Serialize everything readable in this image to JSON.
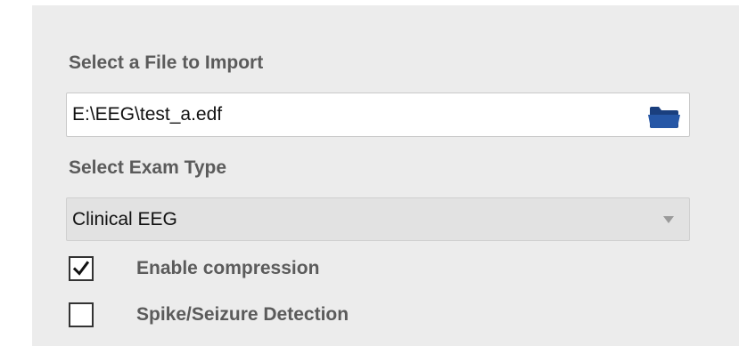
{
  "import_dialog": {
    "file_section": {
      "heading": "Select a File to Import",
      "file_path": "E:\\EEG\\test_a.edf",
      "browse_icon": "folder-icon"
    },
    "exam_section": {
      "heading": "Select Exam Type",
      "selected": "Clinical EEG",
      "dropdown_icon": "chevron-down-icon"
    },
    "options": [
      {
        "label": "Enable compression",
        "checked": true
      },
      {
        "label": "Spike/Seizure Detection",
        "checked": false
      }
    ]
  },
  "colors": {
    "panel_background": "#ececec",
    "label_text": "#5b5b5b",
    "folder_icon": "#1f4e96"
  }
}
